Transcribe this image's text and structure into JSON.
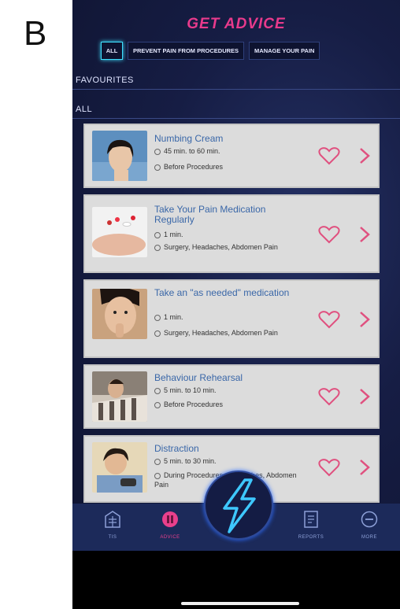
{
  "panel_label": "B",
  "header": {
    "title": "GET ADVICE"
  },
  "tabs": [
    {
      "label": "ALL",
      "active": true
    },
    {
      "label": "PREVENT PAIN FROM PROCEDURES",
      "active": false
    },
    {
      "label": "MANAGE YOUR PAIN",
      "active": false
    }
  ],
  "sections": {
    "favourites": "FAVOURITES",
    "all": "ALL"
  },
  "cards": [
    {
      "title": "Numbing Cream",
      "duration": "45 min. to 60 min.",
      "tags": "Before Procedures"
    },
    {
      "title": "Take Your Pain Medication Regularly",
      "duration": "1 min.",
      "tags": "Surgery, Headaches, Abdomen Pain"
    },
    {
      "title": "Take an \"as needed\" medication",
      "duration": "1 min.",
      "tags": "Surgery, Headaches, Abdomen Pain"
    },
    {
      "title": "Behaviour Rehearsal",
      "duration": "5 min. to 10 min.",
      "tags": "Before Procedures"
    },
    {
      "title": "Distraction",
      "duration": "5 min. to 30 min.",
      "tags": "During Procedures, Headaches, Abdomen Pain"
    }
  ],
  "bottom_nav": [
    {
      "label": "TIS",
      "icon": "building-icon"
    },
    {
      "label": "ADVICE",
      "icon": "advice-icon"
    },
    {
      "label": "",
      "icon": "lightning-icon"
    },
    {
      "label": "REPORTS",
      "icon": "report-icon"
    },
    {
      "label": "MORE",
      "icon": "more-icon"
    }
  ],
  "colors": {
    "accent": "#e93a8c",
    "tab_highlight": "#3ee0ff",
    "card_title": "#3a67a8",
    "background": "#13193a"
  }
}
